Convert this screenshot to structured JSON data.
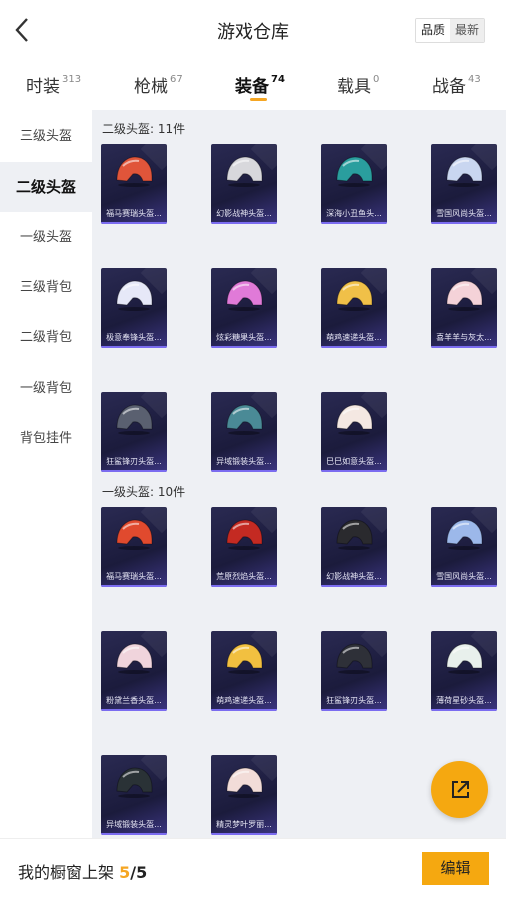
{
  "header": {
    "title": "游戏仓库",
    "sort": [
      "品质",
      "最新"
    ]
  },
  "tabs": [
    {
      "label": "时装",
      "count": "313"
    },
    {
      "label": "枪械",
      "count": "67"
    },
    {
      "label": "装备",
      "count": "74"
    },
    {
      "label": "载具",
      "count": "0"
    },
    {
      "label": "战备",
      "count": "43"
    }
  ],
  "sidebar": [
    "三级头盔",
    "二级头盔",
    "一级头盔",
    "三级背包",
    "二级背包",
    "一级背包",
    "背包挂件"
  ],
  "sections": [
    {
      "title": "二级头盔: 11件",
      "items": [
        {
          "name": "福马赛瑞头盔...",
          "color": "#e0553a"
        },
        {
          "name": "幻影战神头盔...",
          "color": "#d8d8dc"
        },
        {
          "name": "深海小丑鱼头...",
          "color": "#2a9e9e"
        },
        {
          "name": "雪国风尚头盔...",
          "color": "#c9d6f0"
        },
        {
          "name": "极意奉锋头盔...",
          "color": "#e6e8f8"
        },
        {
          "name": "炫彩糖果头盔...",
          "color": "#e07ad8"
        },
        {
          "name": "萌鸡速递头盔...",
          "color": "#f0c048"
        },
        {
          "name": "喜羊羊与灰太...",
          "color": "#f4d2d8"
        },
        {
          "name": "狂鲨锋刃头盔...",
          "color": "#5a6070"
        },
        {
          "name": "异域锻装头盔...",
          "color": "#4a8a96"
        },
        {
          "name": "巳巳如意头盔...",
          "color": "#f4e8e2"
        }
      ]
    },
    {
      "title": "一级头盔: 10件",
      "items": [
        {
          "name": "福马赛瑞头盔...",
          "color": "#e04a2e"
        },
        {
          "name": "荒原烈焰头盔...",
          "color": "#c42a22"
        },
        {
          "name": "幻影战神头盔...",
          "color": "#2a2a2e"
        },
        {
          "name": "雪国风尚头盔...",
          "color": "#9cb8ea"
        },
        {
          "name": "粉黛兰香头盔...",
          "color": "#f0d4dc"
        },
        {
          "name": "萌鸡速递头盔...",
          "color": "#f2c040"
        },
        {
          "name": "狂鲨锋刃头盔...",
          "color": "#2e3038"
        },
        {
          "name": "薄荷星砂头盔...",
          "color": "#e8f0ec"
        },
        {
          "name": "异域锻装头盔...",
          "color": "#2a3236"
        },
        {
          "name": "精灵梦叶罗丽...",
          "color": "#f2dcd8"
        }
      ]
    }
  ],
  "footer": {
    "label": "我的橱窗上架",
    "count": "5",
    "total": "/5",
    "edit": "编辑"
  },
  "colors": {
    "accent": "#f5a810",
    "card_bg": "#1b1b3c",
    "panel_bg": "#eef0f4"
  },
  "icons": {
    "back": "chevron-left-icon",
    "fab": "share-out-icon"
  }
}
